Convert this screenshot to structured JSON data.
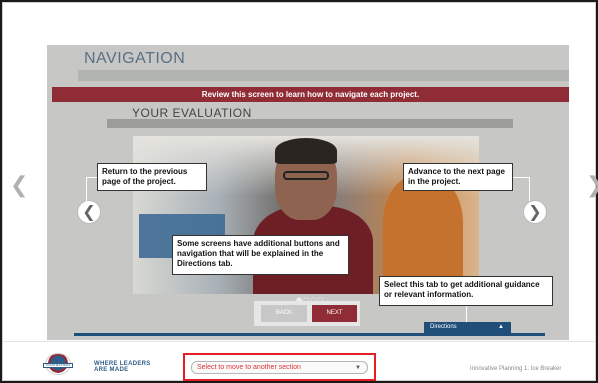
{
  "page": {
    "title": "NAVIGATION",
    "banner": "Review this screen to learn how to navigate each project.",
    "section_title": "YOUR EVALUATION"
  },
  "callouts": {
    "previous": "Return to the previous page of the project.",
    "next": "Advance to the next page in the project.",
    "directions_info": "Some screens have additional buttons and navigation that will be explained in the Directions tab.",
    "tab_info": "Select this tab to get additional guidance or relevant information."
  },
  "slide_nav": {
    "back_label": "BACK",
    "next_label": "NEXT",
    "pager_dots": "●○○○",
    "prev_glyph": "❮",
    "next_glyph": "❯"
  },
  "outer_nav": {
    "prev_glyph": "❮",
    "next_glyph": "❯"
  },
  "directions_tab": {
    "label": "Directions",
    "caret": "▲"
  },
  "footer": {
    "tagline_line1": "WHERE LEADERS",
    "tagline_line2": "ARE MADE",
    "logo_text": "TOASTMASTERS",
    "section_select": {
      "value": "Select to move to another section",
      "caret": "▼"
    },
    "course_label": "Innovative Planning 1: Ice Breaker"
  },
  "colors": {
    "maroon": "#8f2c35",
    "navy": "#1f4e79",
    "highlight_red": "#e31e24",
    "title_blue": "#5a6f86"
  }
}
